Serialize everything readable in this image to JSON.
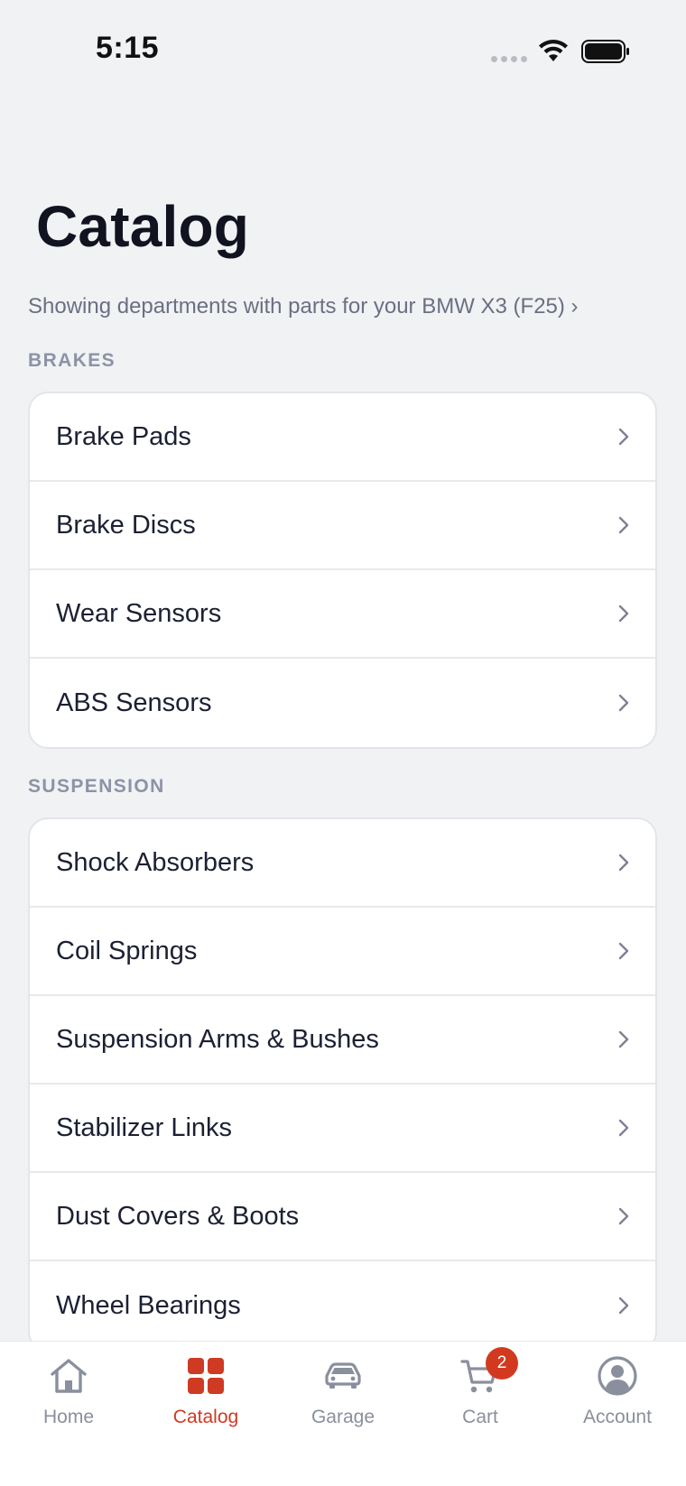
{
  "status_bar": {
    "time": "5:15"
  },
  "page": {
    "title": "Catalog",
    "vehicle_line": "Showing departments with parts for your BMW X3 (F25) ›"
  },
  "sections": [
    {
      "header": "BRAKES",
      "items": [
        "Brake Pads",
        "Brake Discs",
        "Wear Sensors",
        "ABS Sensors"
      ]
    },
    {
      "header": "SUSPENSION",
      "items": [
        "Shock Absorbers",
        "Coil Springs",
        "Suspension Arms & Bushes",
        "Stabilizer Links",
        "Dust Covers & Boots",
        "Wheel Bearings"
      ]
    }
  ],
  "tab_bar": {
    "tabs": [
      {
        "label": "Home",
        "icon": "home-icon"
      },
      {
        "label": "Catalog",
        "icon": "grid-icon",
        "active": true
      },
      {
        "label": "Garage",
        "icon": "car-icon"
      },
      {
        "label": "Cart",
        "icon": "cart-icon",
        "badge": "2"
      },
      {
        "label": "Account",
        "icon": "user-circle-icon"
      }
    ]
  },
  "colors": {
    "accent": "#cf3a22",
    "background": "#f1f2f4",
    "inactive_tab": "#8a8f9d"
  }
}
